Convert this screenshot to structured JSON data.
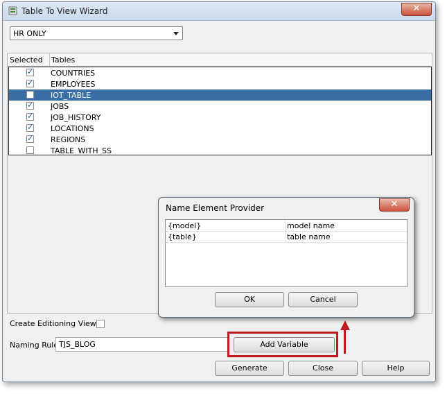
{
  "window": {
    "title": "Table To View Wizard",
    "close_glyph": "✕"
  },
  "schema_select": {
    "value": "HR ONLY"
  },
  "table": {
    "headers": {
      "selected": "Selected",
      "tables": "Tables"
    },
    "rows": [
      {
        "name": "COUNTRIES",
        "checked": true
      },
      {
        "name": "EMPLOYEES",
        "checked": true
      },
      {
        "name": "IOT_TABLE",
        "checked": false,
        "selected": true
      },
      {
        "name": "JOBS",
        "checked": true
      },
      {
        "name": "JOB_HISTORY",
        "checked": true
      },
      {
        "name": "LOCATIONS",
        "checked": true
      },
      {
        "name": "REGIONS",
        "checked": true
      },
      {
        "name": "TABLE_WITH_SS",
        "checked": false
      }
    ]
  },
  "editioning": {
    "label": "Create Editioning Views:"
  },
  "naming_rule": {
    "label": "Naming Rule:",
    "value": "TJS_BLOG"
  },
  "buttons": {
    "add_variable": "Add Variable",
    "generate": "Generate",
    "close": "Close",
    "help": "Help"
  },
  "dialog": {
    "title": "Name Element Provider",
    "close_glyph": "✕",
    "rows": [
      {
        "key": "{model}",
        "value": "model name"
      },
      {
        "key": "{table}",
        "value": "table name"
      }
    ],
    "ok": "OK",
    "cancel": "Cancel"
  },
  "colors": {
    "selection": "#3a6ea5",
    "highlight": "#c0191f"
  }
}
